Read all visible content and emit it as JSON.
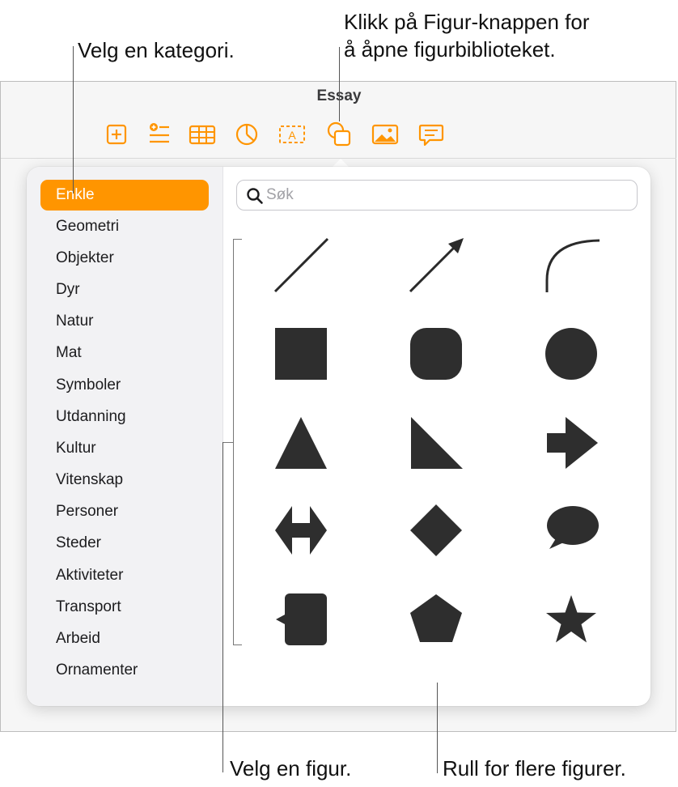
{
  "callouts": {
    "category": "Velg en kategori.",
    "shape_button_line1": "Klikk på Figur-knappen for",
    "shape_button_line2": "å åpne figurbiblioteket.",
    "choose_shape": "Velg en figur.",
    "scroll": "Rull for flere figurer."
  },
  "window": {
    "title": "Essay"
  },
  "toolbar": {
    "items": [
      "add-page-icon",
      "insert-list-icon",
      "table-icon",
      "chart-icon",
      "text-box-icon",
      "shape-icon",
      "media-icon",
      "comment-icon"
    ]
  },
  "accent_color": "#ff9500",
  "sidebar": {
    "selected": "Enkle",
    "categories": [
      "Enkle",
      "Geometri",
      "Objekter",
      "Dyr",
      "Natur",
      "Mat",
      "Symboler",
      "Utdanning",
      "Kultur",
      "Vitenskap",
      "Personer",
      "Steder",
      "Aktiviteter",
      "Transport",
      "Arbeid",
      "Ornamenter"
    ]
  },
  "search": {
    "placeholder": "Søk",
    "value": ""
  },
  "shapes": [
    "line",
    "arrow-line",
    "curve",
    "square",
    "rounded-square",
    "circle",
    "triangle",
    "right-triangle",
    "arrow",
    "double-arrow",
    "diamond",
    "speech-bubble",
    "callout-square",
    "pentagon",
    "star"
  ]
}
